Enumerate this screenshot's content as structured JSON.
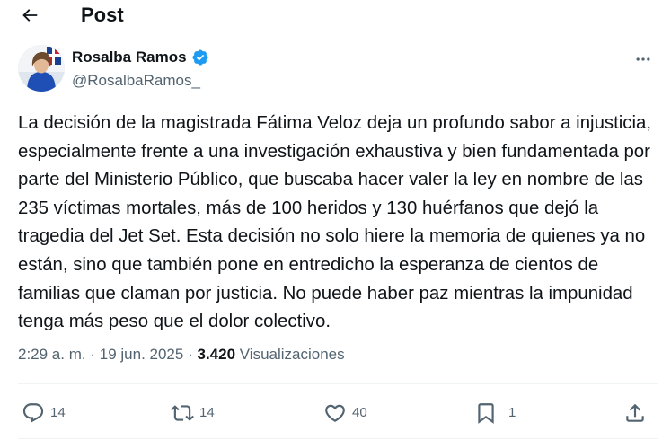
{
  "header": {
    "title": "Post"
  },
  "author": {
    "display_name": "Rosalba Ramos",
    "handle": "@RosalbaRamos_",
    "verified": true
  },
  "tweet": {
    "text": "La decisión de la magistrada Fátima Veloz deja un profundo sabor a injusticia, especialmente frente a una investigación exhaustiva y bien fundamentada por parte del Ministerio Público, que buscaba hacer valer la ley en nombre de las 235 víctimas mortales, más de 100 heridos y 130 huérfanos que dejó la tragedia del Jet Set. Esta decisión no solo hiere la memoria de quienes ya no están, sino que también pone en entredicho la esperanza de cientos de familias que claman por justicia. No puede haber paz mientras la impunidad tenga más peso que el dolor colectivo.",
    "time": "2:29 a. m.",
    "separator": "·",
    "date": "19 jun. 2025",
    "views_count": "3.420",
    "views_label": "Visualizaciones"
  },
  "actions": {
    "replies": "14",
    "reposts": "14",
    "likes": "40",
    "bookmarks": "1"
  },
  "colors": {
    "text": "#0f1419",
    "secondary": "#536471",
    "verified": "#1d9bf0",
    "divider": "#eff3f4"
  },
  "icons": [
    "back-arrow-icon",
    "verified-badge-icon",
    "more-icon",
    "reply-icon",
    "repost-icon",
    "like-icon",
    "bookmark-icon",
    "share-icon"
  ]
}
